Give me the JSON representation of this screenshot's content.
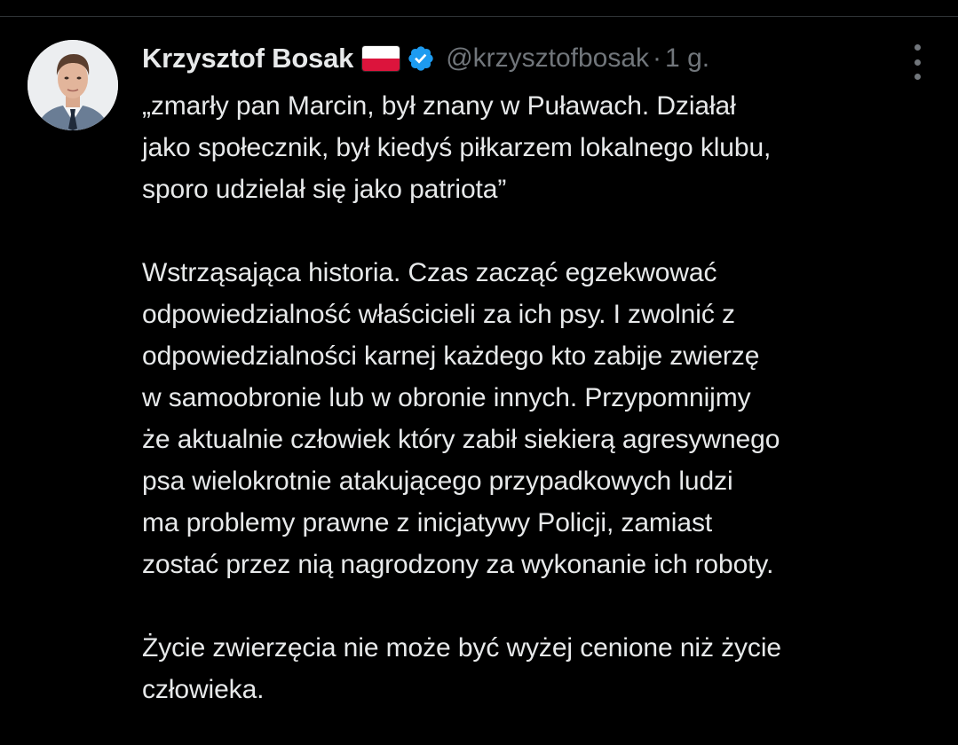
{
  "author": {
    "display_name": "Krzysztof Bosak",
    "handle": "@krzysztofbosak",
    "separator": "·",
    "timestamp": "1 g.",
    "flag_icon": "poland-flag-icon",
    "verified_icon": "verified-badge-icon",
    "verified_color": "#1d9bf0"
  },
  "tweet": {
    "paragraphs": [
      {
        "lines": [
          "„zmarły pan Marcin, był znany w Puławach. Działał",
          "jako społecznik, był kiedyś piłkarzem lokalnego klubu,",
          "sporo udzielał się jako patriota”"
        ]
      },
      {
        "lines": [
          "Wstrząsająca historia. Czas zacząć egzekwować",
          "odpowiedzialność właścicieli za ich psy. I zwolnić z",
          "odpowiedzialności karnej każdego kto zabije zwierzę",
          "w samoobronie lub w obronie innych. Przypomnijmy",
          "że aktualnie człowiek który zabił siekierą agresywnego",
          "psa wielokrotnie atakującego przypadkowych ludzi",
          "ma problemy prawne z inicjatywy Policji, zamiast",
          "zostać przez nią nagrodzony za wykonanie ich roboty."
        ]
      },
      {
        "lines": [
          "Życie zwierzęcia nie może być wyżej cenione niż życie",
          "człowieka."
        ]
      }
    ]
  },
  "more_icon": "more-options-icon",
  "colors": {
    "background": "#000000",
    "text_primary": "#e7e9ea",
    "text_secondary": "#71767b",
    "divider": "#2f3336"
  }
}
